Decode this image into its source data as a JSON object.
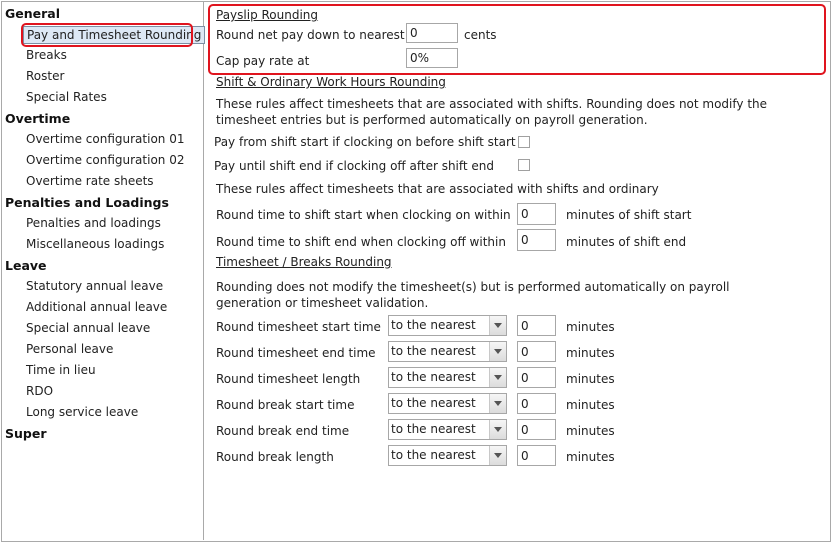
{
  "sidebar": {
    "groups": [
      {
        "label": "General",
        "items": [
          "Pay and Timesheet Rounding",
          "Breaks",
          "Roster",
          "Special Rates"
        ]
      },
      {
        "label": "Overtime",
        "items": [
          "Overtime configuration 01",
          "Overtime configuration 02",
          "Overtime rate sheets"
        ]
      },
      {
        "label": "Penalties and Loadings",
        "items": [
          "Penalties and loadings",
          "Miscellaneous loadings"
        ]
      },
      {
        "label": "Leave",
        "items": [
          "Statutory annual leave",
          "Additional annual leave",
          "Special annual leave",
          "Personal leave",
          "Time in lieu",
          "RDO",
          "Long service leave"
        ]
      },
      {
        "label": "Super",
        "items": []
      }
    ],
    "selected": "Pay and Timesheet Rounding"
  },
  "payslip": {
    "heading": "Payslip Rounding",
    "round_label": "Round net pay down to nearest",
    "round_value": "0",
    "round_unit": "cents",
    "cap_label": "Cap pay rate at",
    "cap_value": "0%"
  },
  "shift": {
    "heading": "Shift & Ordinary Work Hours Rounding",
    "desc": "These rules affect timesheets that are associated with shifts. Rounding does not modify the timesheet entries but is performed automatically on payroll generation.",
    "pay_from_label": "Pay from shift start if clocking on before shift start",
    "pay_until_label": "Pay until shift end if clocking off after shift end",
    "desc2": "These rules affect timesheets that are associated with shifts and ordinary",
    "round_start_label": "Round time to shift start when clocking on within",
    "round_start_value": "0",
    "round_start_unit": "minutes of shift start",
    "round_end_label": "Round time to shift end when clocking off within",
    "round_end_value": "0",
    "round_end_unit": "minutes of shift end"
  },
  "timesheet": {
    "heading": "Timesheet / Breaks Rounding",
    "desc": "Rounding does not modify the timesheet(s) but is performed automatically on payroll generation or timesheet validation.",
    "rows": [
      {
        "label": "Round timesheet start time",
        "mode": "to the nearest",
        "value": "0",
        "unit": "minutes"
      },
      {
        "label": "Round timesheet end time",
        "mode": "to the nearest",
        "value": "0",
        "unit": "minutes"
      },
      {
        "label": "Round timesheet length",
        "mode": "to the nearest",
        "value": "0",
        "unit": "minutes"
      },
      {
        "label": "Round break start time",
        "mode": "to the nearest",
        "value": "0",
        "unit": "minutes"
      },
      {
        "label": "Round break end time",
        "mode": "to the nearest",
        "value": "0",
        "unit": "minutes"
      },
      {
        "label": "Round break length",
        "mode": "to the nearest",
        "value": "0",
        "unit": "minutes"
      }
    ]
  },
  "colors": {
    "highlight": "#e0141e",
    "selected_bg": "#dde8f5"
  }
}
